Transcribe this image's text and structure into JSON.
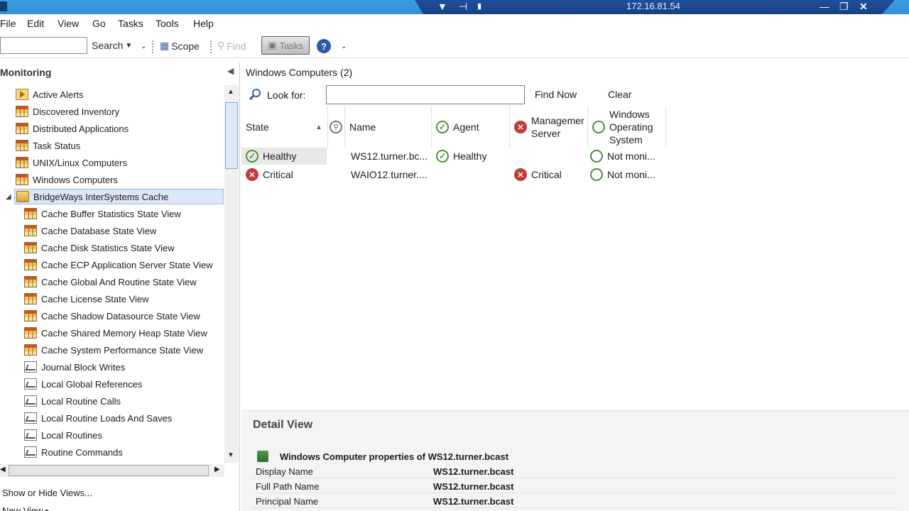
{
  "titlebar": {
    "ip": "172.16.81.54",
    "icons": [
      "pin-icon",
      "signal-icon",
      "minimize-icon",
      "restore-icon",
      "close-icon"
    ]
  },
  "menu": [
    "File",
    "Edit",
    "View",
    "Go",
    "Tasks",
    "Tools",
    "Help"
  ],
  "toolbar": {
    "search_value": "",
    "search_label": "Search",
    "scope_label": "Scope",
    "find_label": "Find",
    "tasks_label": "Tasks"
  },
  "nav": {
    "header": "Monitoring",
    "items": [
      {
        "label": "Active Alerts",
        "icon": "alert"
      },
      {
        "label": "Discovered Inventory",
        "icon": "grid"
      },
      {
        "label": "Distributed Applications",
        "icon": "grid"
      },
      {
        "label": "Task Status",
        "icon": "grid"
      },
      {
        "label": "UNIX/Linux Computers",
        "icon": "grid"
      },
      {
        "label": "Windows Computers",
        "icon": "grid"
      },
      {
        "label": "BridgeWays InterSystems Cache",
        "icon": "folder"
      },
      {
        "label": "Cache Buffer Statistics State View",
        "icon": "grid"
      },
      {
        "label": "Cache Database State View",
        "icon": "grid"
      },
      {
        "label": "Cache Disk Statistics State View",
        "icon": "grid"
      },
      {
        "label": "Cache ECP Application Server State View",
        "icon": "grid"
      },
      {
        "label": "Cache Global And Routine State View",
        "icon": "grid"
      },
      {
        "label": "Cache License State View",
        "icon": "grid"
      },
      {
        "label": "Cache Shadow Datasource State View",
        "icon": "grid"
      },
      {
        "label": "Cache Shared Memory Heap State View",
        "icon": "grid"
      },
      {
        "label": "Cache System Performance State View",
        "icon": "grid"
      },
      {
        "label": "Journal Block Writes",
        "icon": "chart"
      },
      {
        "label": "Local Global References",
        "icon": "chart"
      },
      {
        "label": "Local Routine Calls",
        "icon": "chart"
      },
      {
        "label": "Local Routine Loads And Saves",
        "icon": "chart"
      },
      {
        "label": "Local Routines",
        "icon": "chart"
      },
      {
        "label": "Routine Commands",
        "icon": "chart"
      }
    ],
    "show_hide": "Show or Hide Views...",
    "new_view": "New View ▸"
  },
  "content": {
    "title": "Windows Computers (2)",
    "look_for_label": "Look for:",
    "look_for_value": "",
    "find_now": "Find Now",
    "clear": "Clear",
    "columns": {
      "state": "State",
      "name": "Name",
      "agent": "Agent",
      "mgmt_server": "Managemer Server",
      "win_os": "Windows Operating System"
    },
    "rows": [
      {
        "state": "Healthy",
        "name": "WS12.turner.bc...",
        "agent": "Healthy",
        "mgmt_server": "",
        "win_os": "Not moni..."
      },
      {
        "state": "Critical",
        "name": "WAIO12.turner....",
        "agent": "",
        "mgmt_server": "Critical",
        "win_os": "Not moni..."
      }
    ]
  },
  "detail": {
    "title": "Detail View",
    "subtitle": "Windows Computer properties of WS12.turner.bcast",
    "properties": [
      {
        "key": "Display Name",
        "value": "WS12.turner.bcast"
      },
      {
        "key": "Full Path Name",
        "value": "WS12.turner.bcast"
      },
      {
        "key": "Principal Name",
        "value": "WS12.turner.bcast"
      }
    ]
  }
}
